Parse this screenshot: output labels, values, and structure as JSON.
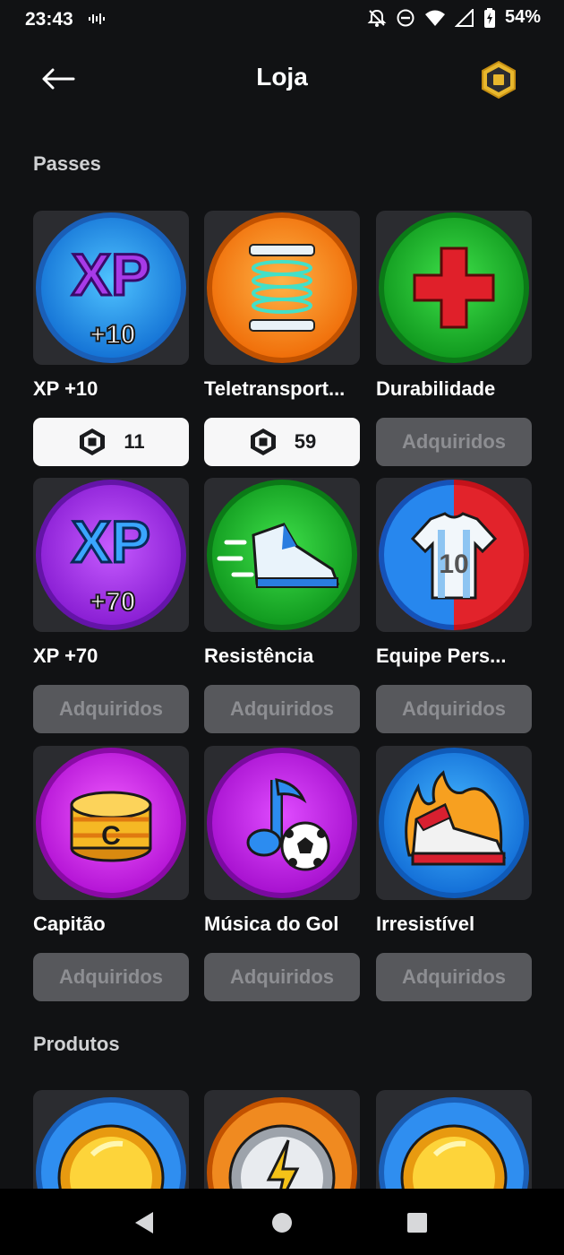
{
  "status_bar": {
    "time": "23:43",
    "battery": "54%",
    "icons": [
      "voicemail-wave-icon",
      "bell-off-icon",
      "do-not-disturb-icon",
      "wifi-icon",
      "signal-icon",
      "battery-charging-icon"
    ]
  },
  "header": {
    "title": "Loja",
    "back_icon": "arrow-left-icon",
    "currency_icon": "robux-icon"
  },
  "sections": {
    "passes_title": "Passes",
    "products_title": "Produtos"
  },
  "passes": [
    {
      "name": "XP +10",
      "price": "11",
      "state": "price",
      "art": "xp-10-icon",
      "badge_text": "XP",
      "sub_text": "+10"
    },
    {
      "name": "Teletransport...",
      "price": "59",
      "state": "price",
      "art": "teleport-icon"
    },
    {
      "name": "Durabilidade",
      "state": "owned",
      "label": "Adquiridos",
      "art": "health-cross-icon"
    },
    {
      "name": "XP +70",
      "state": "owned",
      "label": "Adquiridos",
      "art": "xp-70-icon",
      "badge_text": "XP",
      "sub_text": "+70"
    },
    {
      "name": "Resistência",
      "state": "owned",
      "label": "Adquiridos",
      "art": "running-shoe-icon"
    },
    {
      "name": "Equipe Pers...",
      "state": "owned",
      "label": "Adquiridos",
      "art": "jersey-icon",
      "jersey_number": "10"
    },
    {
      "name": "Capitão",
      "state": "owned",
      "label": "Adquiridos",
      "art": "captain-armband-icon",
      "armband_letter": "C"
    },
    {
      "name": "Música do Gol",
      "state": "owned",
      "label": "Adquiridos",
      "art": "music-ball-icon"
    },
    {
      "name": "Irresistível",
      "state": "owned",
      "label": "Adquiridos",
      "art": "flaming-sneaker-icon"
    }
  ],
  "products": [
    {
      "art": "gold-coin-icon"
    },
    {
      "art": "energy-coin-icon"
    },
    {
      "art": "gold-coin-icon"
    }
  ],
  "nav": [
    "back-triangle-icon",
    "home-circle-icon",
    "recents-square-icon"
  ],
  "colors": {
    "background": "#111214",
    "card": "#2b2c30",
    "owned_button": "#57585c",
    "price_button": "#f7f7f8"
  }
}
